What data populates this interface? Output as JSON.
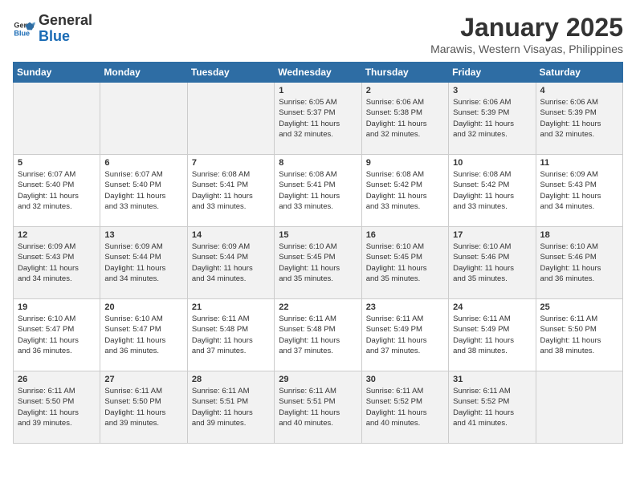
{
  "logo": {
    "line1": "General",
    "line2": "Blue"
  },
  "title": "January 2025",
  "subtitle": "Marawis, Western Visayas, Philippines",
  "weekdays": [
    "Sunday",
    "Monday",
    "Tuesday",
    "Wednesday",
    "Thursday",
    "Friday",
    "Saturday"
  ],
  "weeks": [
    [
      {
        "day": "",
        "info": ""
      },
      {
        "day": "",
        "info": ""
      },
      {
        "day": "",
        "info": ""
      },
      {
        "day": "1",
        "info": "Sunrise: 6:05 AM\nSunset: 5:37 PM\nDaylight: 11 hours\nand 32 minutes."
      },
      {
        "day": "2",
        "info": "Sunrise: 6:06 AM\nSunset: 5:38 PM\nDaylight: 11 hours\nand 32 minutes."
      },
      {
        "day": "3",
        "info": "Sunrise: 6:06 AM\nSunset: 5:39 PM\nDaylight: 11 hours\nand 32 minutes."
      },
      {
        "day": "4",
        "info": "Sunrise: 6:06 AM\nSunset: 5:39 PM\nDaylight: 11 hours\nand 32 minutes."
      }
    ],
    [
      {
        "day": "5",
        "info": "Sunrise: 6:07 AM\nSunset: 5:40 PM\nDaylight: 11 hours\nand 32 minutes."
      },
      {
        "day": "6",
        "info": "Sunrise: 6:07 AM\nSunset: 5:40 PM\nDaylight: 11 hours\nand 33 minutes."
      },
      {
        "day": "7",
        "info": "Sunrise: 6:08 AM\nSunset: 5:41 PM\nDaylight: 11 hours\nand 33 minutes."
      },
      {
        "day": "8",
        "info": "Sunrise: 6:08 AM\nSunset: 5:41 PM\nDaylight: 11 hours\nand 33 minutes."
      },
      {
        "day": "9",
        "info": "Sunrise: 6:08 AM\nSunset: 5:42 PM\nDaylight: 11 hours\nand 33 minutes."
      },
      {
        "day": "10",
        "info": "Sunrise: 6:08 AM\nSunset: 5:42 PM\nDaylight: 11 hours\nand 33 minutes."
      },
      {
        "day": "11",
        "info": "Sunrise: 6:09 AM\nSunset: 5:43 PM\nDaylight: 11 hours\nand 34 minutes."
      }
    ],
    [
      {
        "day": "12",
        "info": "Sunrise: 6:09 AM\nSunset: 5:43 PM\nDaylight: 11 hours\nand 34 minutes."
      },
      {
        "day": "13",
        "info": "Sunrise: 6:09 AM\nSunset: 5:44 PM\nDaylight: 11 hours\nand 34 minutes."
      },
      {
        "day": "14",
        "info": "Sunrise: 6:09 AM\nSunset: 5:44 PM\nDaylight: 11 hours\nand 34 minutes."
      },
      {
        "day": "15",
        "info": "Sunrise: 6:10 AM\nSunset: 5:45 PM\nDaylight: 11 hours\nand 35 minutes."
      },
      {
        "day": "16",
        "info": "Sunrise: 6:10 AM\nSunset: 5:45 PM\nDaylight: 11 hours\nand 35 minutes."
      },
      {
        "day": "17",
        "info": "Sunrise: 6:10 AM\nSunset: 5:46 PM\nDaylight: 11 hours\nand 35 minutes."
      },
      {
        "day": "18",
        "info": "Sunrise: 6:10 AM\nSunset: 5:46 PM\nDaylight: 11 hours\nand 36 minutes."
      }
    ],
    [
      {
        "day": "19",
        "info": "Sunrise: 6:10 AM\nSunset: 5:47 PM\nDaylight: 11 hours\nand 36 minutes."
      },
      {
        "day": "20",
        "info": "Sunrise: 6:10 AM\nSunset: 5:47 PM\nDaylight: 11 hours\nand 36 minutes."
      },
      {
        "day": "21",
        "info": "Sunrise: 6:11 AM\nSunset: 5:48 PM\nDaylight: 11 hours\nand 37 minutes."
      },
      {
        "day": "22",
        "info": "Sunrise: 6:11 AM\nSunset: 5:48 PM\nDaylight: 11 hours\nand 37 minutes."
      },
      {
        "day": "23",
        "info": "Sunrise: 6:11 AM\nSunset: 5:49 PM\nDaylight: 11 hours\nand 37 minutes."
      },
      {
        "day": "24",
        "info": "Sunrise: 6:11 AM\nSunset: 5:49 PM\nDaylight: 11 hours\nand 38 minutes."
      },
      {
        "day": "25",
        "info": "Sunrise: 6:11 AM\nSunset: 5:50 PM\nDaylight: 11 hours\nand 38 minutes."
      }
    ],
    [
      {
        "day": "26",
        "info": "Sunrise: 6:11 AM\nSunset: 5:50 PM\nDaylight: 11 hours\nand 39 minutes."
      },
      {
        "day": "27",
        "info": "Sunrise: 6:11 AM\nSunset: 5:50 PM\nDaylight: 11 hours\nand 39 minutes."
      },
      {
        "day": "28",
        "info": "Sunrise: 6:11 AM\nSunset: 5:51 PM\nDaylight: 11 hours\nand 39 minutes."
      },
      {
        "day": "29",
        "info": "Sunrise: 6:11 AM\nSunset: 5:51 PM\nDaylight: 11 hours\nand 40 minutes."
      },
      {
        "day": "30",
        "info": "Sunrise: 6:11 AM\nSunset: 5:52 PM\nDaylight: 11 hours\nand 40 minutes."
      },
      {
        "day": "31",
        "info": "Sunrise: 6:11 AM\nSunset: 5:52 PM\nDaylight: 11 hours\nand 41 minutes."
      },
      {
        "day": "",
        "info": ""
      }
    ]
  ]
}
